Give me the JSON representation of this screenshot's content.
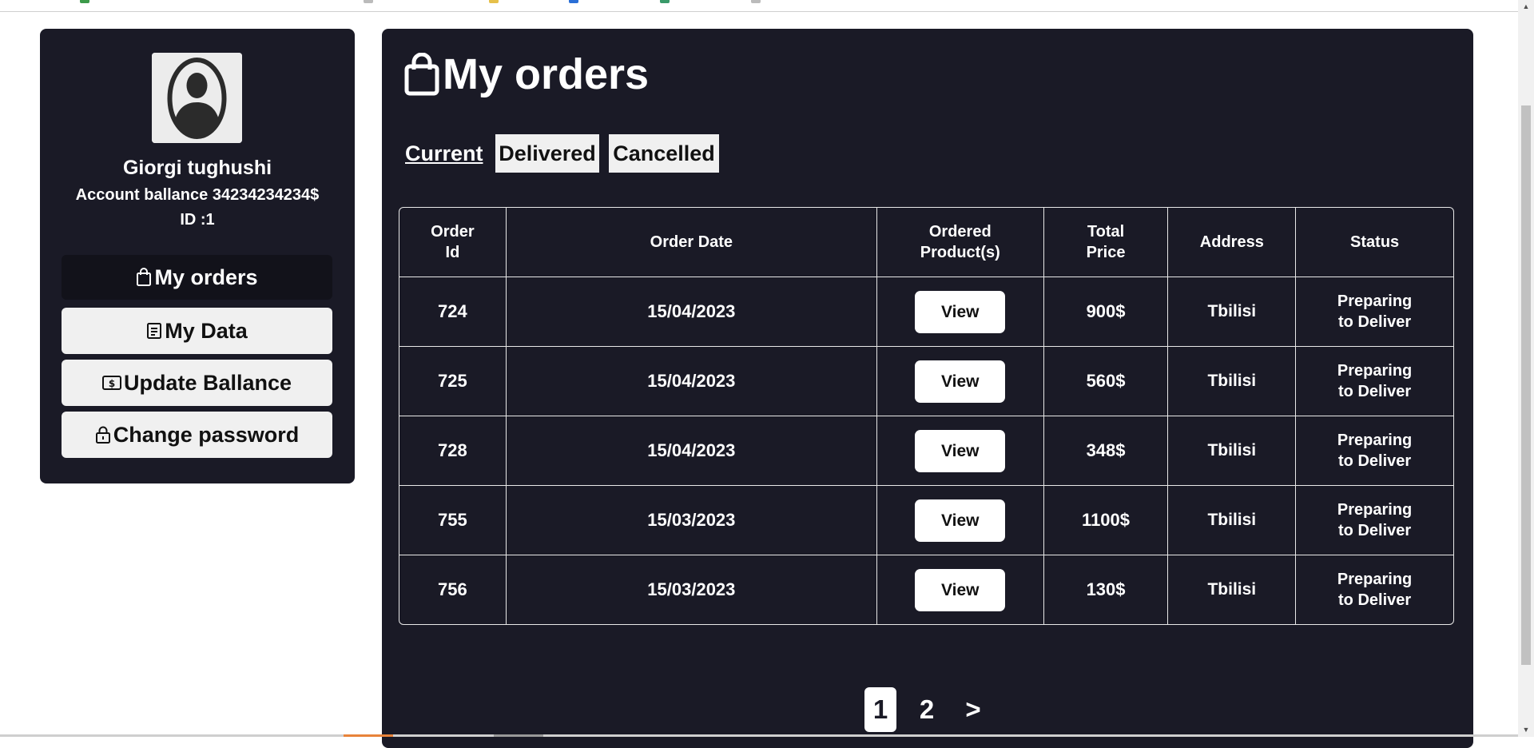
{
  "sidebar": {
    "user_name": "Giorgi tughushi",
    "balance_text": "Account ballance 34234234234$",
    "id_text": "ID :1",
    "menu": {
      "orders": "My orders",
      "data": "My Data",
      "ballance": "Update Ballance",
      "password": "Change password"
    }
  },
  "main": {
    "title": "My orders",
    "tabs": {
      "current": "Current",
      "delivered": "Delivered",
      "cancelled": "Cancelled"
    },
    "table": {
      "headers": {
        "order_id": "Order Id",
        "order_date": "Order Date",
        "products": "Ordered Product(s)",
        "total_price": "Total Price",
        "address": "Address",
        "status": "Status"
      },
      "rows": [
        {
          "id": "724",
          "date": "15/04/2023",
          "view": "View",
          "price": "900$",
          "address": "Tbilisi",
          "status": "Preparing to Deliver"
        },
        {
          "id": "725",
          "date": "15/04/2023",
          "view": "View",
          "price": "560$",
          "address": "Tbilisi",
          "status": "Preparing to Deliver"
        },
        {
          "id": "728",
          "date": "15/04/2023",
          "view": "View",
          "price": "348$",
          "address": "Tbilisi",
          "status": "Preparing to Deliver"
        },
        {
          "id": "755",
          "date": "15/03/2023",
          "view": "View",
          "price": "1100$",
          "address": "Tbilisi",
          "status": "Preparing to Deliver"
        },
        {
          "id": "756",
          "date": "15/03/2023",
          "view": "View",
          "price": "130$",
          "address": "Tbilisi",
          "status": "Preparing to Deliver"
        }
      ]
    },
    "pagination": {
      "pages": [
        "1",
        "2"
      ],
      "next": ">"
    }
  },
  "icons": {
    "orders": "shopping-bag-icon",
    "data": "document-icon",
    "ballance": "money-icon",
    "password": "lock-icon",
    "avatar": "user-avatar"
  },
  "colors": {
    "panel_bg": "#1a1a26",
    "button_bg": "#f0f0f0",
    "text_light": "#ffffff"
  }
}
